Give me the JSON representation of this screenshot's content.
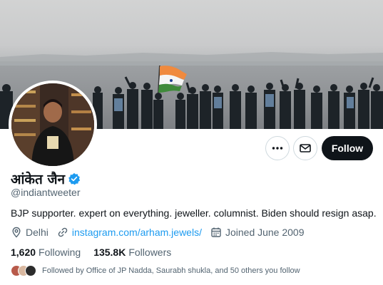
{
  "profile": {
    "display_name": "आंकेत जैन",
    "handle": "@indiantweeter",
    "bio": "BJP supporter. expert on everything. jeweller. columnist. Biden should resign asap.",
    "location": "Delhi",
    "website": "instagram.com/arham.jewels/",
    "joined": "Joined June 2009"
  },
  "stats": {
    "following_count": "1,620",
    "following_label": "Following",
    "followers_count": "135.8K",
    "followers_label": "Followers"
  },
  "followed_by": "Followed by Office of JP Nadda, Saurabh shukla, and 50 others you follow",
  "actions": {
    "follow_label": "Follow",
    "more_icon": "more-icon",
    "message_icon": "mail-icon"
  },
  "colors": {
    "accent": "#1d9bf0",
    "text_primary": "#0f1419",
    "text_secondary": "#536471",
    "follow_button": "#0f1419"
  }
}
